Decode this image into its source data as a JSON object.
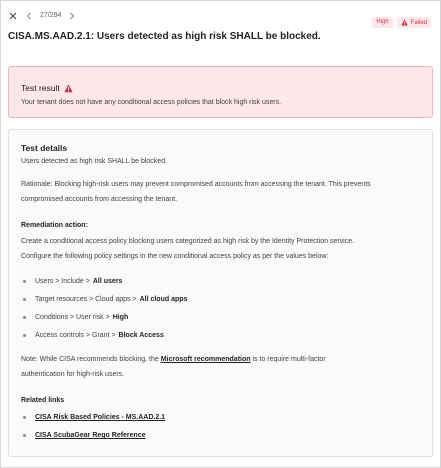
{
  "nav": {
    "counter": "27/294"
  },
  "badges": {
    "severity": "High",
    "status": "Failed"
  },
  "title": "CISA.MS.AAD.2.1: Users detected as high risk SHALL be blocked.",
  "result": {
    "heading": "Test result",
    "message": "Your tenant does not have any conditional access policies that block high risk users."
  },
  "details": {
    "heading": "Test details",
    "summary": "Users detected as high risk SHALL be blocked.",
    "rationale_line1": "Rationale: Blocking high-risk users may prevent compromised accounts from accessing the tenant. This prevents",
    "rationale_line2": "compromised accounts from accessing the tenant.",
    "remediation_heading": "Remediation action:",
    "remediation_line1": "Create a conditional access policy blocking users categorized as high risk by the Identity Protection service.",
    "remediation_line2": "Configure the following policy settings in the new conditional access policy as per the values below:",
    "settings": [
      {
        "path": "Users > Include >",
        "value": "All users"
      },
      {
        "path": "Target resources > Cloud apps >",
        "value": "All cloud apps"
      },
      {
        "path": "Conditions > User risk >",
        "value": "High"
      },
      {
        "path": "Access controls > Grant >",
        "value": "Block Access"
      }
    ],
    "note_prefix": "Note: While CISA recommends blocking, the",
    "note_link": "Microsoft recommendation",
    "note_suffix": "is to require multi-factor",
    "note_line2": "authentication for high-risk users.",
    "related_heading": "Related links",
    "links": [
      "CISA Risk Based Policies - MS.AAD.2.1",
      "CISA ScubaGear Rego Reference"
    ]
  },
  "colors": {
    "danger": "#c4314b",
    "danger_bg": "#fde7e9"
  },
  "icons": {
    "close": "close-icon",
    "prev": "chevron-left-icon",
    "next": "chevron-right-icon",
    "warning": "warning-icon"
  }
}
